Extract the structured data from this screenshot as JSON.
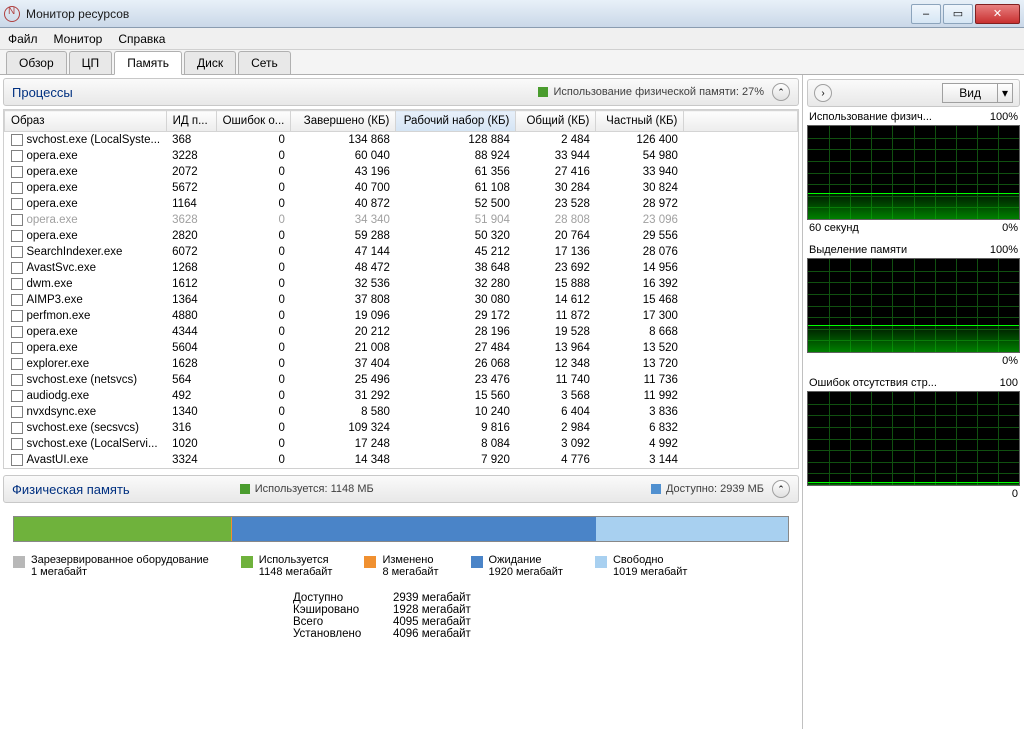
{
  "window": {
    "title": "Монитор ресурсов"
  },
  "menu": {
    "file": "Файл",
    "monitor": "Монитор",
    "help": "Справка"
  },
  "tabs": {
    "overview": "Обзор",
    "cpu": "ЦП",
    "memory": "Память",
    "disk": "Диск",
    "network": "Сеть"
  },
  "processes": {
    "title": "Процессы",
    "usage_label": "Использование физической памяти: 27%",
    "columns": {
      "image": "Образ",
      "pid": "ИД п...",
      "faults": "Ошибок о...",
      "commit": "Завершено (КБ)",
      "working": "Рабочий набор (КБ)",
      "shared": "Общий (КБ)",
      "private": "Частный (КБ)"
    },
    "rows": [
      {
        "image": "svchost.exe (LocalSyste...",
        "pid": "368",
        "faults": "0",
        "commit": "134 868",
        "working": "128 884",
        "shared": "2 484",
        "private": "126 400"
      },
      {
        "image": "opera.exe",
        "pid": "3228",
        "faults": "0",
        "commit": "60 040",
        "working": "88 924",
        "shared": "33 944",
        "private": "54 980"
      },
      {
        "image": "opera.exe",
        "pid": "2072",
        "faults": "0",
        "commit": "43 196",
        "working": "61 356",
        "shared": "27 416",
        "private": "33 940"
      },
      {
        "image": "opera.exe",
        "pid": "5672",
        "faults": "0",
        "commit": "40 700",
        "working": "61 108",
        "shared": "30 284",
        "private": "30 824"
      },
      {
        "image": "opera.exe",
        "pid": "1164",
        "faults": "0",
        "commit": "40 872",
        "working": "52 500",
        "shared": "23 528",
        "private": "28 972"
      },
      {
        "image": "opera.exe",
        "pid": "3628",
        "faults": "0",
        "commit": "34 340",
        "working": "51 904",
        "shared": "28 808",
        "private": "23 096",
        "dim": true
      },
      {
        "image": "opera.exe",
        "pid": "2820",
        "faults": "0",
        "commit": "59 288",
        "working": "50 320",
        "shared": "20 764",
        "private": "29 556"
      },
      {
        "image": "SearchIndexer.exe",
        "pid": "6072",
        "faults": "0",
        "commit": "47 144",
        "working": "45 212",
        "shared": "17 136",
        "private": "28 076"
      },
      {
        "image": "AvastSvc.exe",
        "pid": "1268",
        "faults": "0",
        "commit": "48 472",
        "working": "38 648",
        "shared": "23 692",
        "private": "14 956"
      },
      {
        "image": "dwm.exe",
        "pid": "1612",
        "faults": "0",
        "commit": "32 536",
        "working": "32 280",
        "shared": "15 888",
        "private": "16 392"
      },
      {
        "image": "AIMP3.exe",
        "pid": "1364",
        "faults": "0",
        "commit": "37 808",
        "working": "30 080",
        "shared": "14 612",
        "private": "15 468"
      },
      {
        "image": "perfmon.exe",
        "pid": "4880",
        "faults": "0",
        "commit": "19 096",
        "working": "29 172",
        "shared": "11 872",
        "private": "17 300"
      },
      {
        "image": "opera.exe",
        "pid": "4344",
        "faults": "0",
        "commit": "20 212",
        "working": "28 196",
        "shared": "19 528",
        "private": "8 668"
      },
      {
        "image": "opera.exe",
        "pid": "5604",
        "faults": "0",
        "commit": "21 008",
        "working": "27 484",
        "shared": "13 964",
        "private": "13 520"
      },
      {
        "image": "explorer.exe",
        "pid": "1628",
        "faults": "0",
        "commit": "37 404",
        "working": "26 068",
        "shared": "12 348",
        "private": "13 720"
      },
      {
        "image": "svchost.exe (netsvcs)",
        "pid": "564",
        "faults": "0",
        "commit": "25 496",
        "working": "23 476",
        "shared": "11 740",
        "private": "11 736"
      },
      {
        "image": "audiodg.exe",
        "pid": "492",
        "faults": "0",
        "commit": "31 292",
        "working": "15 560",
        "shared": "3 568",
        "private": "11 992"
      },
      {
        "image": "nvxdsync.exe",
        "pid": "1340",
        "faults": "0",
        "commit": "8 580",
        "working": "10 240",
        "shared": "6 404",
        "private": "3 836"
      },
      {
        "image": "svchost.exe (secsvcs)",
        "pid": "316",
        "faults": "0",
        "commit": "109 324",
        "working": "9 816",
        "shared": "2 984",
        "private": "6 832"
      },
      {
        "image": "svchost.exe (LocalServi...",
        "pid": "1020",
        "faults": "0",
        "commit": "17 248",
        "working": "8 084",
        "shared": "3 092",
        "private": "4 992"
      },
      {
        "image": "AvastUI.exe",
        "pid": "3324",
        "faults": "0",
        "commit": "14 348",
        "working": "7 920",
        "shared": "4 776",
        "private": "3 144"
      }
    ]
  },
  "physical": {
    "title": "Физическая память",
    "used_label": "Используется: 1148 МБ",
    "avail_label": "Доступно: 2939 МБ",
    "legend": {
      "reserved": {
        "label": "Зарезервированное оборудование",
        "value": "1 мегабайт",
        "color": "#b8b8b8"
      },
      "used": {
        "label": "Используется",
        "value": "1148 мегабайт",
        "color": "#6fb23c"
      },
      "modified": {
        "label": "Изменено",
        "value": "8 мегабайт",
        "color": "#f09030"
      },
      "standby": {
        "label": "Ожидание",
        "value": "1920 мегабайт",
        "color": "#4a84c8"
      },
      "free": {
        "label": "Свободно",
        "value": "1019 мегабайт",
        "color": "#a8d0f0"
      }
    },
    "stats": {
      "available": {
        "k": "Доступно",
        "v": "2939 мегабайт"
      },
      "cached": {
        "k": "Кэшировано",
        "v": "1928 мегабайт"
      },
      "total": {
        "k": "Всего",
        "v": "4095 мегабайт"
      },
      "installed": {
        "k": "Установлено",
        "v": "4096 мегабайт"
      }
    }
  },
  "right": {
    "view": "Вид",
    "charts": [
      {
        "title": "Использование физич...",
        "top_right": "100%",
        "bottom_left": "60 секунд",
        "bottom_right": "0%",
        "level": 27
      },
      {
        "title": "Выделение памяти",
        "top_right": "100%",
        "bottom_left": "",
        "bottom_right": "0%",
        "level": 28
      },
      {
        "title": "Ошибок отсутствия стр...",
        "top_right": "100",
        "bottom_left": "",
        "bottom_right": "0",
        "level": 2
      }
    ]
  }
}
